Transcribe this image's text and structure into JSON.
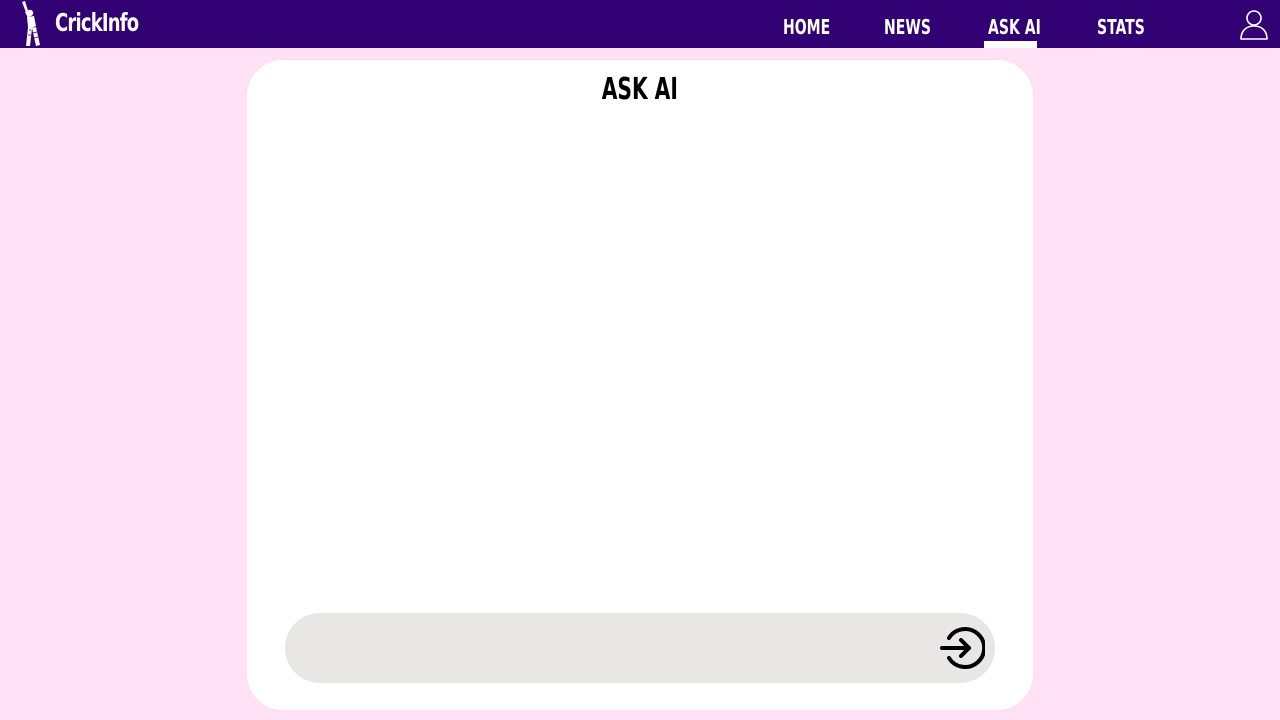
{
  "header": {
    "brand": "CrickInfo",
    "logo_icon": "cricket-batsman-icon",
    "user_icon": "user-icon",
    "background_color": "#310073",
    "nav": [
      {
        "label": "HOME",
        "active": false
      },
      {
        "label": "NEWS",
        "active": false
      },
      {
        "label": "ASK AI",
        "active": true
      },
      {
        "label": "STATS",
        "active": false
      }
    ]
  },
  "main": {
    "title": "ASK AI",
    "chat_input": {
      "value": "",
      "placeholder": ""
    },
    "send_icon": "enter-arrow-icon"
  },
  "colors": {
    "page_background": "#fee1f5",
    "panel_background": "#ffffff",
    "input_background": "#e9e7e6"
  }
}
